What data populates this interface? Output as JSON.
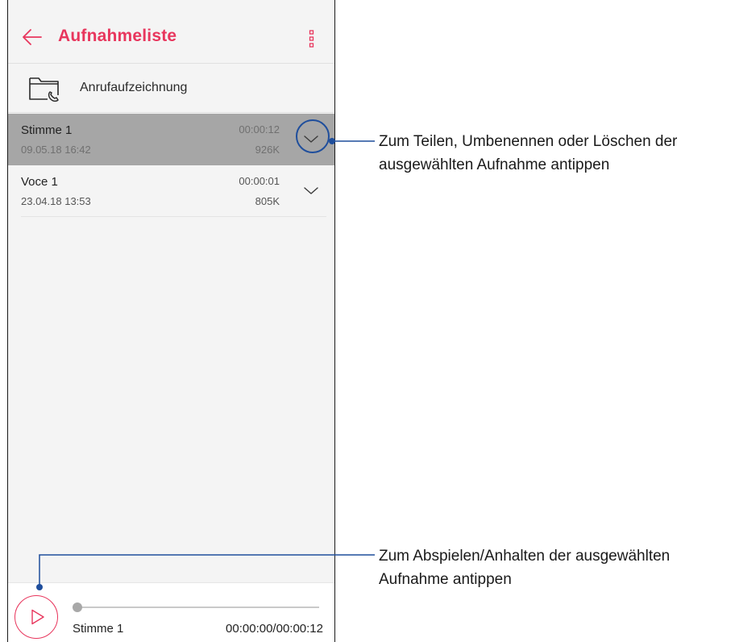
{
  "app": {
    "title": "Aufnahmeliste",
    "back_icon": "arrow-left-icon",
    "menu_icon": "more-vert-icon",
    "accent_color": "#e8365d"
  },
  "folder": {
    "icon": "folder-phone-icon",
    "label": "Anrufaufzeichnung"
  },
  "recordings": [
    {
      "name": "Stimme 1",
      "date": "09.05.18 16:42",
      "duration": "00:00:12",
      "size": "926K",
      "selected": true,
      "expand_icon": "chevron-down-icon"
    },
    {
      "name": "Voce 1",
      "date": "23.04.18 13:53",
      "duration": "00:00:01",
      "size": "805K",
      "selected": false,
      "expand_icon": "chevron-down-icon"
    }
  ],
  "player": {
    "play_icon": "play-icon",
    "name": "Stimme 1",
    "time": "00:00:00/00:00:12",
    "progress": 0
  },
  "callouts": [
    {
      "line1": "Zum Teilen, Umbenennen oder Löschen der",
      "line2": "ausgewählten Aufnahme antippen",
      "color": "#1f4e9c"
    },
    {
      "line1": "Zum Abspielen/Anhalten der ausgewählten",
      "line2": "Aufnahme antippen",
      "color": "#1f4e9c"
    }
  ]
}
